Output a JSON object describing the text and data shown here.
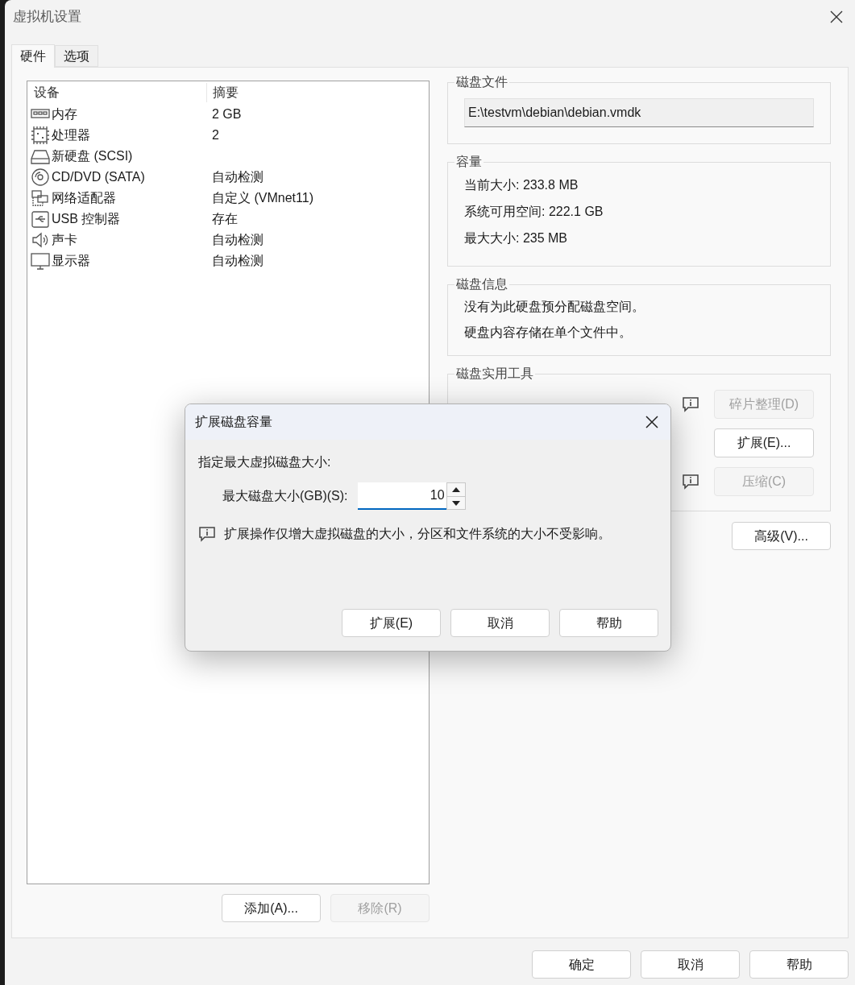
{
  "window": {
    "title": "虚拟机设置"
  },
  "tabs": [
    {
      "label": "硬件",
      "selected": true
    },
    {
      "label": "选项",
      "selected": false
    }
  ],
  "devices": {
    "columns": [
      "设备",
      "摘要"
    ],
    "rows": [
      {
        "kind": "memory",
        "name": "内存",
        "summary": "2 GB"
      },
      {
        "kind": "cpu",
        "name": "处理器",
        "summary": "2"
      },
      {
        "kind": "disk",
        "name": "新硬盘 (SCSI)"
      },
      {
        "kind": "cd",
        "name": "CD/DVD (SATA)",
        "summary": "自动检测"
      },
      {
        "kind": "network",
        "name": "网络适配器",
        "summary": "自定义 (VMnet11)"
      },
      {
        "kind": "usb",
        "name": "USB 控制器",
        "summary": "存在"
      },
      {
        "kind": "sound",
        "name": "声卡",
        "summary": "自动检测"
      },
      {
        "kind": "display",
        "name": "显示器",
        "summary": "自动检测"
      }
    ]
  },
  "device_buttons": [
    {
      "label": "添加(A)...",
      "disabled": false
    },
    {
      "label": "移除(R)",
      "disabled": true
    }
  ],
  "disk_file": {
    "legend": "磁盘文件",
    "path": "E:\\testvm\\debian\\debian.vmdk"
  },
  "capacity": {
    "legend": "容量",
    "lines": [
      "当前大小: 233.8 MB",
      "系统可用空间: 222.1 GB",
      "最大大小: 235 MB"
    ]
  },
  "disk_info": {
    "legend": "磁盘信息",
    "lines": [
      "没有为此硬盘预分配磁盘空间。",
      "硬盘内容存储在单个文件中。"
    ]
  },
  "disk_utilities": {
    "legend": "磁盘实用工具",
    "actions": [
      {
        "label": "碎片整理(D)",
        "disabled": true,
        "info": true
      },
      {
        "label": "扩展(E)...",
        "disabled": false,
        "info": false
      },
      {
        "label": "压缩(C)",
        "disabled": true,
        "info": true
      }
    ]
  },
  "advanced_button": {
    "label": "高级(V)...",
    "disabled": false
  },
  "footer_buttons": [
    {
      "label": "确定",
      "disabled": false
    },
    {
      "label": "取消",
      "disabled": false
    },
    {
      "label": "帮助",
      "disabled": false
    }
  ],
  "dialog": {
    "title": "扩展磁盘容量",
    "prompt": "指定最大虚拟磁盘大小:",
    "size_label": "最大磁盘大小(GB)(S):",
    "size_value": "10",
    "note": "扩展操作仅增大虚拟磁盘的大小，分区和文件系统的大小不受影响。",
    "buttons": [
      {
        "label": "扩展(E)",
        "disabled": false
      },
      {
        "label": "取消",
        "disabled": false
      },
      {
        "label": "帮助",
        "disabled": false
      }
    ]
  }
}
